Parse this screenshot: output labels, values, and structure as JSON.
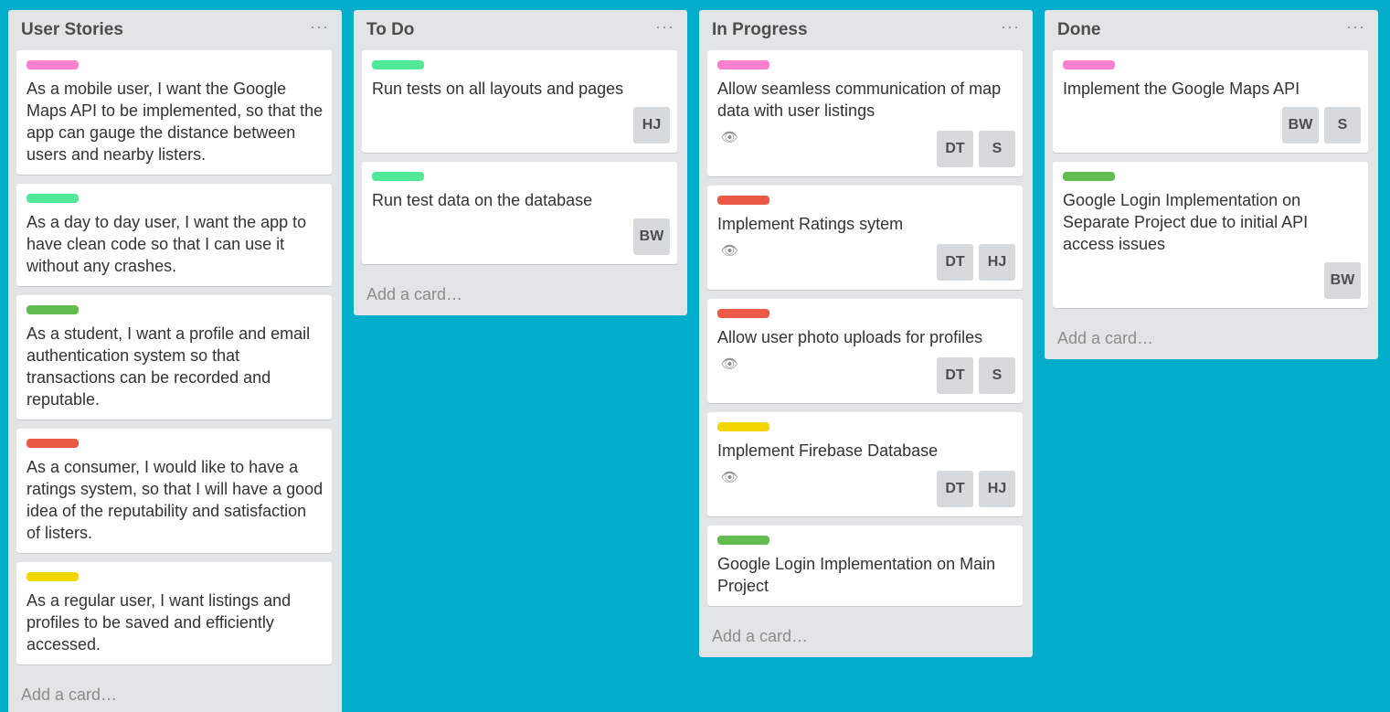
{
  "colors": {
    "board_bg": "#00AECC",
    "pink": "#FF80CE",
    "mint": "#51E898",
    "green": "#61BD4F",
    "red": "#EB5A46",
    "yellow": "#F2D600"
  },
  "lists": [
    {
      "title": "User Stories",
      "add_card": "Add a card…",
      "cards": [
        {
          "label": "pink",
          "text": "As a mobile user, I want the Google Maps API to be implemented, so that the app can gauge the distance between users and nearby listers.",
          "members": [],
          "watch": false
        },
        {
          "label": "mint",
          "text": "As a day to day user, I want the app to have clean code so that I can use it without any crashes.",
          "members": [],
          "watch": false
        },
        {
          "label": "green",
          "text": "As a student, I want a profile and email authentication system so that transactions can be recorded and reputable.",
          "members": [],
          "watch": false
        },
        {
          "label": "red",
          "text": "As a consumer, I would like to have a ratings system, so that I will have a good idea of the reputability and satisfaction of listers.",
          "members": [],
          "watch": false
        },
        {
          "label": "yellow",
          "text": "As a regular user, I want listings and profiles to be saved and efficiently accessed.",
          "members": [],
          "watch": false
        }
      ]
    },
    {
      "title": "To Do",
      "add_card": "Add a card…",
      "cards": [
        {
          "label": "mint",
          "text": "Run tests on all layouts and pages",
          "members": [
            "HJ"
          ],
          "watch": false
        },
        {
          "label": "mint",
          "text": "Run test data on the database",
          "members": [
            "BW"
          ],
          "watch": false
        }
      ]
    },
    {
      "title": "In Progress",
      "add_card": "Add a card…",
      "cards": [
        {
          "label": "pink",
          "text": "Allow seamless communication of map data with user listings",
          "members": [
            "DT",
            "S"
          ],
          "watch": true
        },
        {
          "label": "red",
          "text": "Implement Ratings sytem",
          "members": [
            "DT",
            "HJ"
          ],
          "watch": true
        },
        {
          "label": "red",
          "text": "Allow user photo uploads for profiles",
          "members": [
            "DT",
            "S"
          ],
          "watch": true
        },
        {
          "label": "yellow",
          "text": "Implement Firebase Database",
          "members": [
            "DT",
            "HJ"
          ],
          "watch": true
        },
        {
          "label": "green",
          "text": "Google Login Implementation on Main Project",
          "members": [],
          "watch": false
        }
      ]
    },
    {
      "title": "Done",
      "add_card": "Add a card…",
      "cards": [
        {
          "label": "pink",
          "text": "Implement the Google Maps API",
          "members": [
            "BW",
            "S"
          ],
          "watch": false
        },
        {
          "label": "green",
          "text": "Google Login Implementation on Separate Project due to initial API access issues",
          "members": [
            "BW"
          ],
          "watch": false
        }
      ]
    }
  ]
}
